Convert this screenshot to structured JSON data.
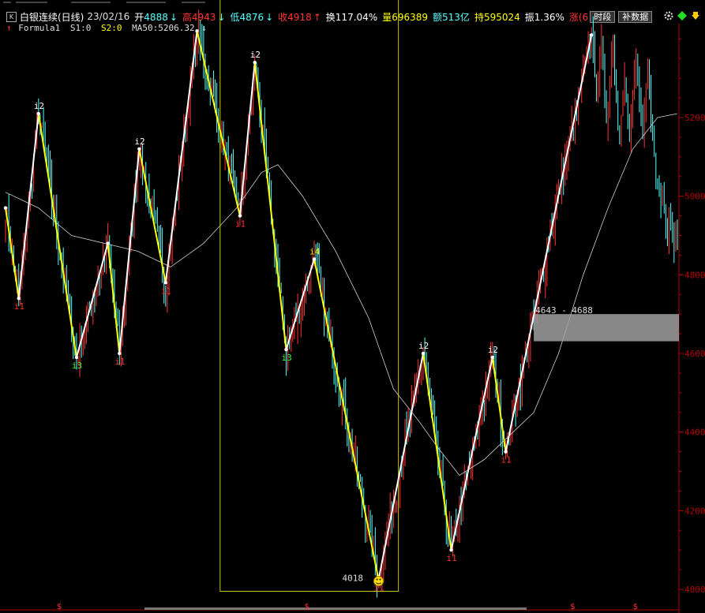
{
  "header": {
    "k_icon": "K",
    "name": "白银连续(日线)",
    "date": "23/02/16",
    "open_label": "开",
    "open": "4888",
    "open_arrow": "↓",
    "high_label": "高",
    "high": "4943",
    "high_arrow": "↓",
    "low_label": "低",
    "low": "4876",
    "low_arrow": "↓",
    "close_label": "收",
    "close": "4918",
    "close_arrow": "↑",
    "turnover_label": "换",
    "turnover": "117.04%",
    "volume_label": "量",
    "volume": "696389",
    "amount_label": "额",
    "amount": "513亿",
    "hold_label": "持",
    "hold": "595024",
    "amp_label": "振",
    "amp": "1.36%",
    "rise_label": "涨",
    "rise": "(6",
    "btn_period": "时段",
    "btn_supplement": "补数据",
    "icons": [
      "gear-icon",
      "diamond-icon",
      "down-arrow-icon"
    ]
  },
  "legend": {
    "arrow": "↑",
    "formula": "Formula1",
    "s1": "S1:0",
    "s2": "S2:0",
    "ma": "MA50:5206.32",
    "ma_arrow": "↓"
  },
  "colors": {
    "up": "#ff3333",
    "down": "#54ffff",
    "zig": "#ffff00",
    "zig_up": "#ffffff",
    "ma": "#d0d0d0",
    "box": "#c8c800",
    "band": "#a0a0a0",
    "axis": "#b00000"
  },
  "chart_data": {
    "type": "candlestick",
    "ylim": [
      3990,
      5520
    ],
    "y_ticks": [
      4000,
      4200,
      4400,
      4600,
      4800,
      5000,
      5200
    ],
    "pivots": [
      {
        "i": 0,
        "price": 4970,
        "label": ""
      },
      {
        "i": 8,
        "price": 4740,
        "label": "i1"
      },
      {
        "i": 20,
        "price": 5210,
        "label": "i2"
      },
      {
        "i": 43,
        "price": 4590,
        "label": "i3"
      },
      {
        "i": 62,
        "price": 4880,
        "label": ""
      },
      {
        "i": 69,
        "price": 4600,
        "label": "i1"
      },
      {
        "i": 81,
        "price": 5120,
        "label": "i2"
      },
      {
        "i": 97,
        "price": 4780,
        "label": "i1"
      },
      {
        "i": 116,
        "price": 5420,
        "label": ""
      },
      {
        "i": 142,
        "price": 4950,
        "label": "i1"
      },
      {
        "i": 151,
        "price": 5340,
        "label": "i2"
      },
      {
        "i": 170,
        "price": 4610,
        "label": "i3"
      },
      {
        "i": 187,
        "price": 4840,
        "label": "i4"
      },
      {
        "i": 226,
        "price": 4025,
        "label": "i1"
      },
      {
        "i": 253,
        "price": 4600,
        "label": "i2"
      },
      {
        "i": 270,
        "price": 4100,
        "label": "i1"
      },
      {
        "i": 295,
        "price": 4590,
        "label": "i2"
      },
      {
        "i": 303,
        "price": 4350,
        "label": "i1"
      },
      {
        "i": 355,
        "price": 5410,
        "label": ""
      }
    ],
    "extra_candles": [
      {
        "from": 356,
        "to": 407,
        "closes": [
          5380,
          5310,
          5250,
          5280,
          5350,
          5400,
          5330,
          5260,
          5190,
          5230,
          5300,
          5350,
          5380,
          5320,
          5250,
          5180,
          5140,
          5200,
          5260,
          5300,
          5260,
          5200,
          5150,
          5210,
          5270,
          5320,
          5340,
          5300,
          5250,
          5200,
          5180,
          5220,
          5280,
          5310,
          5260,
          5200,
          5150,
          5100,
          5050,
          5040,
          5000,
          4980,
          5010,
          4960,
          4920,
          4900,
          4960,
          4930,
          4890,
          4870,
          4900,
          4880
        ]
      }
    ],
    "ma50": [
      [
        0,
        5010
      ],
      [
        20,
        4970
      ],
      [
        40,
        4900
      ],
      [
        60,
        4880
      ],
      [
        80,
        4860
      ],
      [
        100,
        4820
      ],
      [
        120,
        4880
      ],
      [
        140,
        4970
      ],
      [
        155,
        5060
      ],
      [
        165,
        5080
      ],
      [
        180,
        5000
      ],
      [
        200,
        4860
      ],
      [
        220,
        4690
      ],
      [
        235,
        4510
      ],
      [
        250,
        4430
      ],
      [
        262,
        4360
      ],
      [
        275,
        4290
      ],
      [
        290,
        4330
      ],
      [
        305,
        4390
      ],
      [
        320,
        4450
      ],
      [
        335,
        4600
      ],
      [
        350,
        4800
      ],
      [
        365,
        4970
      ],
      [
        380,
        5120
      ],
      [
        395,
        5200
      ],
      [
        407,
        5210
      ]
    ],
    "annotations": {
      "low_value": "4018",
      "low_index": 226,
      "band_label": "4643 - 4688",
      "band_low": 4643,
      "band_high": 4688,
      "band_from": 320,
      "box_from": 130,
      "box_to": 238,
      "box_top": 5520,
      "box_bottom": 3995,
      "bottom_markers": [
        33,
        183,
        344,
        382
      ]
    }
  }
}
